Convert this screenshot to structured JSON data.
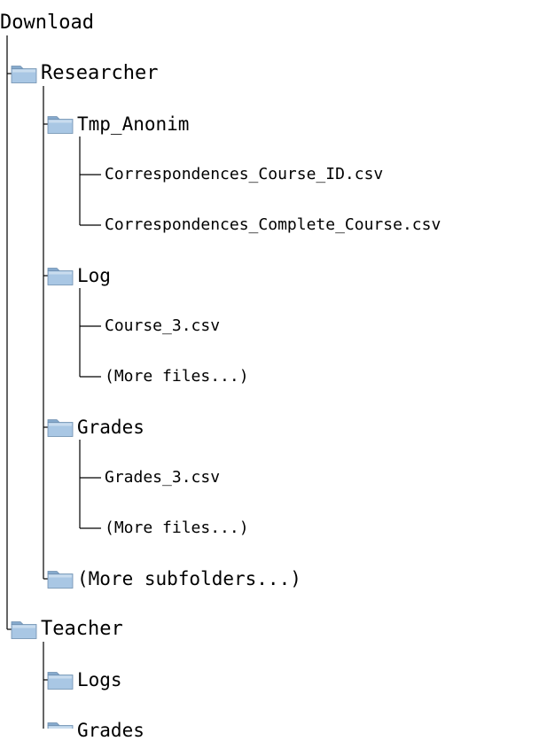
{
  "tree": {
    "root": {
      "label": "Download",
      "children": [
        {
          "label": "Researcher",
          "icon": "folder-icon",
          "children": [
            {
              "label": "Tmp_Anonim",
              "icon": "folder-icon",
              "children": [
                {
                  "label": "Correspondences_Course_ID.csv"
                },
                {
                  "label": "Correspondences_Complete_Course.csv"
                }
              ]
            },
            {
              "label": "Log",
              "icon": "folder-icon",
              "children": [
                {
                  "label": "Course_3.csv"
                },
                {
                  "label": "(More files...)"
                }
              ]
            },
            {
              "label": "Grades",
              "icon": "folder-icon",
              "children": [
                {
                  "label": "Grades_3.csv"
                },
                {
                  "label": "(More files...)"
                }
              ]
            },
            {
              "label": "(More subfolders...)",
              "icon": "folder-icon",
              "children": []
            }
          ]
        },
        {
          "label": "Teacher",
          "icon": "folder-icon",
          "children": [
            {
              "label": "Logs",
              "icon": "folder-icon",
              "children": []
            },
            {
              "label": "Grades",
              "icon": "folder-icon",
              "children": []
            }
          ]
        }
      ]
    }
  },
  "colors": {
    "line": "#000000",
    "folder_body": "#a9c7e4",
    "folder_tab": "#86aacd",
    "folder_outline": "#6f8fb0",
    "text": "#000000"
  }
}
